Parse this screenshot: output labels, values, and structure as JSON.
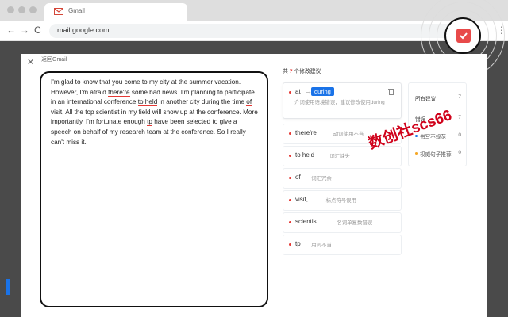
{
  "browser": {
    "tab_title": "Gmail",
    "url": "mail.google.com",
    "nav_back": "←",
    "nav_forward": "→",
    "nav_reload": "C",
    "menu": "⋮"
  },
  "modal": {
    "close": "✕",
    "back_label": "返回Gmail"
  },
  "essay": {
    "segments": [
      {
        "t": "I'm glad to know that you come to my city "
      },
      {
        "t": "at",
        "err": true
      },
      {
        "t": " the summer vacation. However, I'm afraid "
      },
      {
        "t": "there're",
        "err": true
      },
      {
        "t": " some bad news. I'm planning to participate in an international conference "
      },
      {
        "t": "to held",
        "err": true
      },
      {
        "t": " in another city during the time "
      },
      {
        "t": "of",
        "err": true
      },
      {
        "t": " "
      },
      {
        "t": "visit,",
        "err": true
      },
      {
        "t": " All the top "
      },
      {
        "t": "scientist",
        "err": true
      },
      {
        "t": " in my field will show up at the conference. More importantly, I'm fortunate enough "
      },
      {
        "t": "tp",
        "err": true
      },
      {
        "t": " have been selected to give a speech on behalf of my research team at the conference. So I really can't miss it."
      }
    ]
  },
  "suggestions": {
    "count_prefix": "共",
    "count": "7",
    "count_suffix": "个修改建议",
    "items": [
      {
        "word": "at",
        "arrow": "→",
        "suggestion": "during",
        "hint": "介词使用语境错误，建议修改使用during",
        "active": true
      },
      {
        "word": "there're",
        "hint": "动词使用不当"
      },
      {
        "word": "to held",
        "hint": "词汇缺失"
      },
      {
        "word": "of",
        "hint": "词汇冗余"
      },
      {
        "word": "visit,",
        "hint": "标点符号误用"
      },
      {
        "word": "scientist",
        "hint": "名词单复数错误"
      },
      {
        "word": "tp",
        "hint": "用词不当"
      }
    ]
  },
  "filter": {
    "items": [
      {
        "label": "所有建议",
        "count": "7"
      },
      {
        "label": "错误",
        "count": "7"
      },
      {
        "label": "书写不规范",
        "count": "0",
        "dot": "#1a73e8"
      },
      {
        "label": "权威句子推荐",
        "count": "0",
        "dot": "#f5a623"
      }
    ]
  },
  "watermark": "数创社scs66",
  "colors": {
    "accent": "#1a73e8",
    "error": "#e53935",
    "watermark": "#d0021b"
  }
}
